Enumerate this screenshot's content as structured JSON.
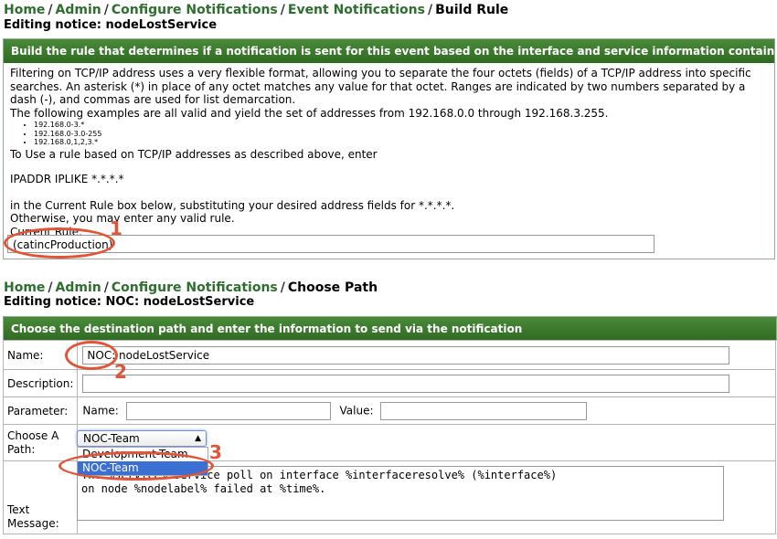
{
  "top": {
    "breadcrumb": [
      "Home",
      "Admin",
      "Configure Notifications",
      "Event Notifications"
    ],
    "breadcrumb_current": "Build Rule",
    "separator": "/",
    "subtitle": "Editing notice: nodeLostService",
    "panel_header": "Build the rule that determines if a notification is sent for this event based on the interface and service information contained in the event.",
    "para1": "Filtering on TCP/IP address uses a very flexible format, allowing you to separate the four octets (fields) of a TCP/IP address into specific searches. An asterisk (*) in place of any octet matches any value for that octet. Ranges are indicated by two numbers separated by a dash (-), and commas are used for list demarcation.",
    "para2": "The following examples are all valid and yield the set of addresses from 192.168.0.0 through 192.168.3.255.",
    "examples": [
      "192.168.0-3.*",
      "192.168.0-3.0-255",
      "192.168.0,1,2,3.*"
    ],
    "para3": "To Use a rule based on TCP/IP addresses as described above, enter",
    "para4": "IPADDR IPLIKE *.*.*.*",
    "para5": "in the Current Rule box below, substituting your desired address fields for *.*.*.*.",
    "para6": "Otherwise, you may enter any valid rule.",
    "current_rule_label": "Current Rule:",
    "current_rule_value": "(catincProduction)"
  },
  "bottom": {
    "breadcrumb": [
      "Home",
      "Admin",
      "Configure Notifications"
    ],
    "breadcrumb_current": "Choose Path",
    "subtitle": "Editing notice: NOC: nodeLostService",
    "panel_header": "Choose the destination path and enter the information to send via the notification",
    "name_label": "Name:",
    "name_value": "NOC: nodeLostService",
    "description_label": "Description:",
    "parameter_label": "Parameter:",
    "param_name_label": "Name:",
    "param_value_label": "Value:",
    "path_label_1": "Choose A",
    "path_label_2": "Path:",
    "path_selected": "NOC-Team",
    "path_options": [
      "Development-Team",
      "NOC-Team"
    ],
    "text_message_label_1": "Text",
    "text_message_label_2": "Message:",
    "text_message_value": "The %service% service poll on interface %interfaceresolve% (%interface%)\non node %nodelabel% failed at %time%."
  },
  "annotations": [
    "1",
    "2",
    "3"
  ],
  "colors": {
    "link": "#2e6e2e",
    "header": "#2f6a22",
    "annotation": "#e0553a",
    "highlight": "#3b6fd1"
  }
}
